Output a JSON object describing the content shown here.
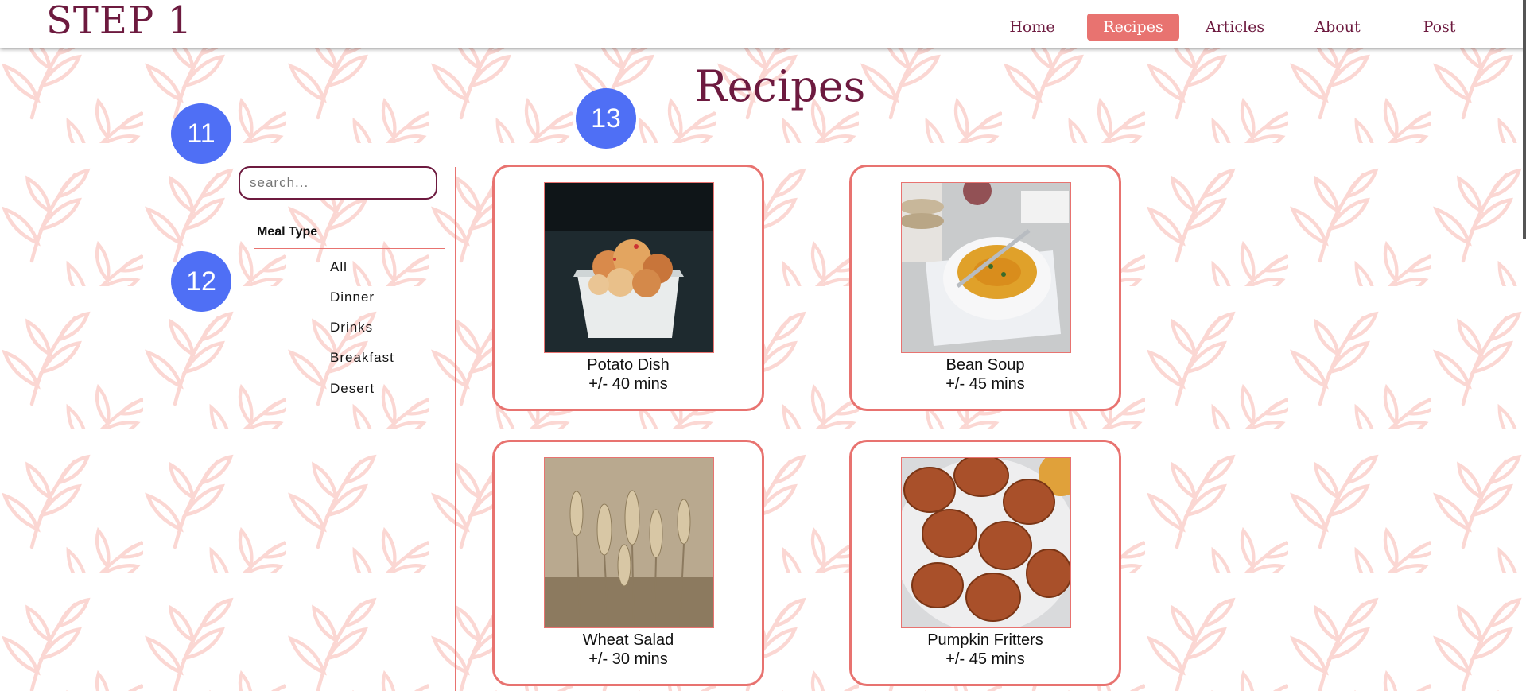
{
  "header": {
    "logo": "STEP 1",
    "nav": [
      {
        "label": "Home",
        "active": false
      },
      {
        "label": "Recipes",
        "active": true
      },
      {
        "label": "Articles",
        "active": false
      },
      {
        "label": "About",
        "active": false
      },
      {
        "label": "Post",
        "active": false
      }
    ]
  },
  "page": {
    "title": "Recipes"
  },
  "badges": [
    "11",
    "12",
    "13"
  ],
  "sidebar": {
    "search_placeholder": "search...",
    "filter_heading": "Meal Type",
    "filters": [
      "All",
      "Dinner",
      "Drinks",
      "Breakfast",
      "Desert"
    ]
  },
  "recipes": [
    {
      "name": "Potato Dish",
      "time": "+/- 40 mins",
      "image": "potato-dish-photo"
    },
    {
      "name": "Bean Soup",
      "time": "+/- 45 mins",
      "image": "bean-soup-photo"
    },
    {
      "name": "Wheat Salad",
      "time": "+/- 30 mins",
      "image": "wheat-salad-photo"
    },
    {
      "name": "Pumpkin Fritters",
      "time": "+/- 45 mins",
      "image": "pumpkin-fritters-photo"
    }
  ],
  "colors": {
    "brand": "#6d1a3f",
    "accent": "#e87370",
    "badge": "#4f6ff5"
  }
}
